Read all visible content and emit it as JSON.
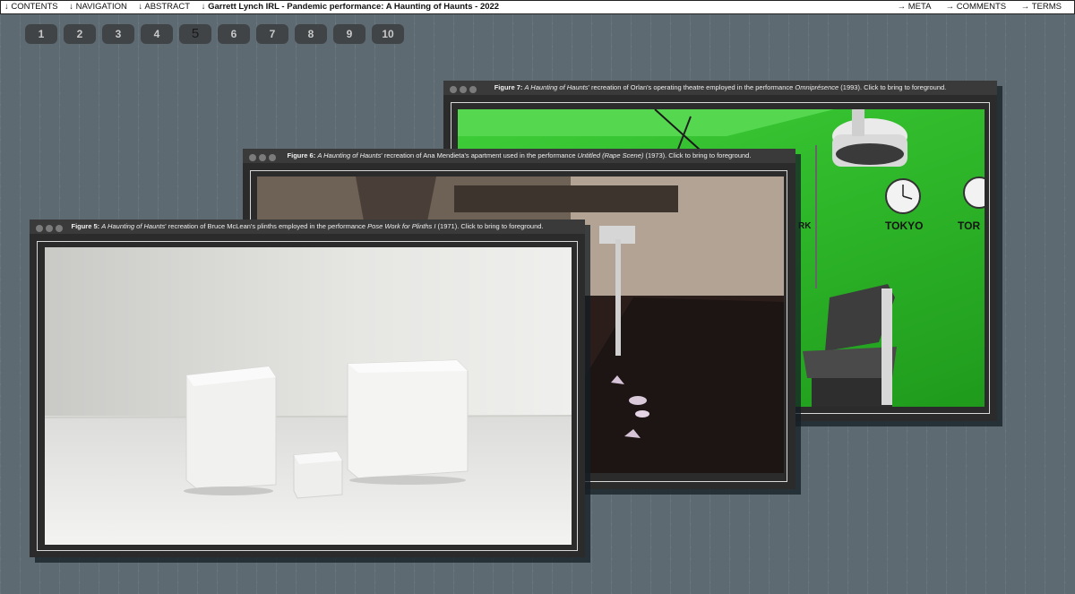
{
  "topbar": {
    "contents": "↓ CONTENTS",
    "navigation": "↓ NAVIGATION",
    "abstract": "↓ ABSTRACT",
    "title": "↓  Garrett Lynch IRL - Pandemic performance: A Haunting of Haunts - 2022",
    "meta": "→ META",
    "comments": "→ COMMENTS",
    "terms": "→ TERMS"
  },
  "pages": [
    "1",
    "2",
    "3",
    "4",
    "5",
    "6",
    "7",
    "8",
    "9",
    "10"
  ],
  "active_page": "5",
  "figures": {
    "fig7": {
      "label": "Figure 7:",
      "title": "A Haunting of Haunts",
      "before_work": "' recreation of Orlan's operating theatre employed in the performance ",
      "work": "Omniprésence",
      "after_work": " (1993). Click to bring to foreground.",
      "clock_label_1": "TOKYO",
      "clock_label_2": "TOR",
      "clock_label_3": "RK"
    },
    "fig6": {
      "label": "Figure 6:",
      "title": "A Haunting of Haunts",
      "before_work": "' recreation of Ana Mendieta's apartment used in the performance ",
      "work": "Untitled (Rape Scene)",
      "after_work": " (1973). Click to bring to foreground."
    },
    "fig5": {
      "label": "Figure 5:",
      "title": "A Haunting of Haunts",
      "before_work": "' recreation of Bruce McLean's plinths employed in the performance ",
      "work": "Pose Work for Plinths I",
      "after_work": " (1971). Click to bring to foreground."
    }
  }
}
